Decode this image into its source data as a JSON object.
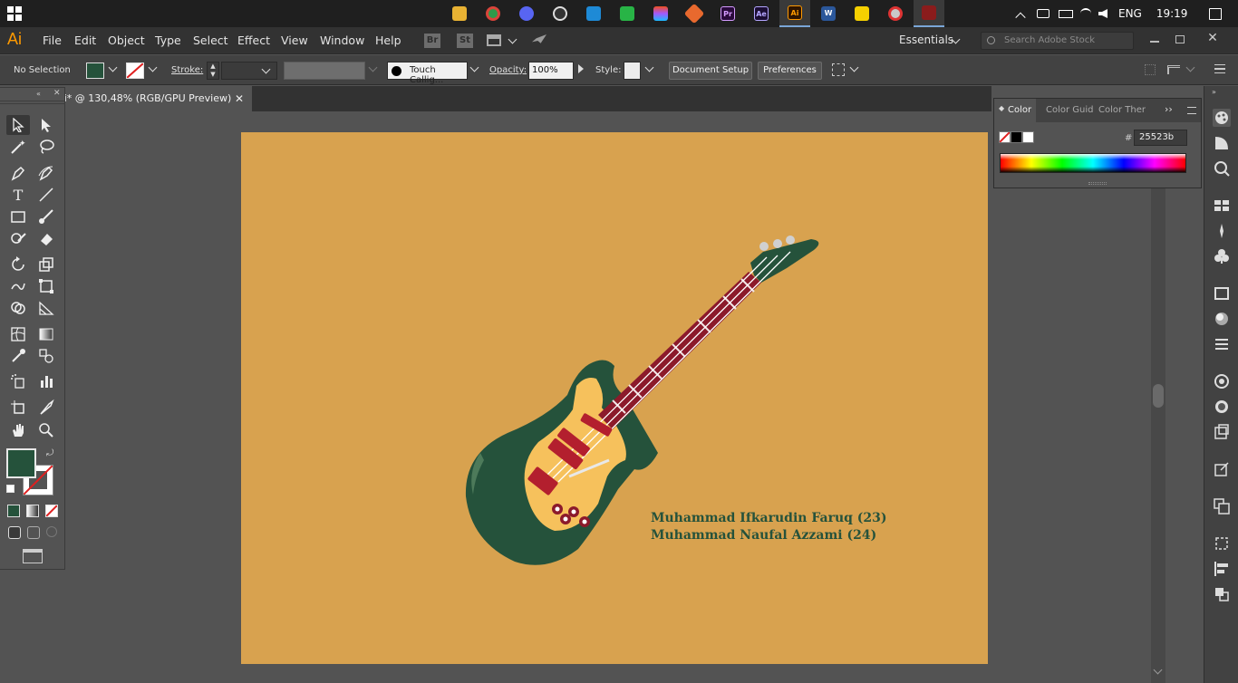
{
  "taskbar": {
    "apps": [
      "file-explorer",
      "chrome",
      "discord",
      "obs",
      "vscode",
      "app-green",
      "figma",
      "app-orange",
      "premiere-pro",
      "after-effects",
      "illustrator",
      "word",
      "sticky-notes",
      "app-red",
      "app-active"
    ],
    "app_labels": {
      "premiere": "Pr",
      "after_effects": "Ae",
      "illustrator": "Ai",
      "word": "W"
    },
    "language": "ENG",
    "time": "19:19"
  },
  "menubar": {
    "logo": "Ai",
    "items": [
      "File",
      "Edit",
      "Object",
      "Type",
      "Select",
      "Effect",
      "View",
      "Window",
      "Help"
    ],
    "bridge": "Br",
    "stock_icon": "St",
    "workspace": "Essentials",
    "search_placeholder": "Search Adobe Stock"
  },
  "controlbar": {
    "selection": "No Selection",
    "stroke_label": "Stroke:",
    "brush": "Touch Callig...",
    "opacity_label": "Opacity:",
    "opacity_value": "100%",
    "style_label": "Style:",
    "document_setup": "Document Setup",
    "preferences": "Preferences",
    "fill_color": "#25523b"
  },
  "document": {
    "tab_title": "ai* @ 130,48% (RGB/GPU Preview)",
    "artboard_color": "#d8a24f",
    "credits": [
      "Muhammad Ifkarudin Faruq (23)",
      "Muhammad Naufal Azzami (24)"
    ]
  },
  "color_panel": {
    "tabs": [
      "Color",
      "Color Guid",
      "Color Ther"
    ],
    "hex_label": "#",
    "hex_value": "25523b"
  },
  "colors": {
    "guitar_body": "#25523b",
    "pickguard": "#f6c15c",
    "neck": "#8c1a2b",
    "accent": "#b31f2e"
  }
}
